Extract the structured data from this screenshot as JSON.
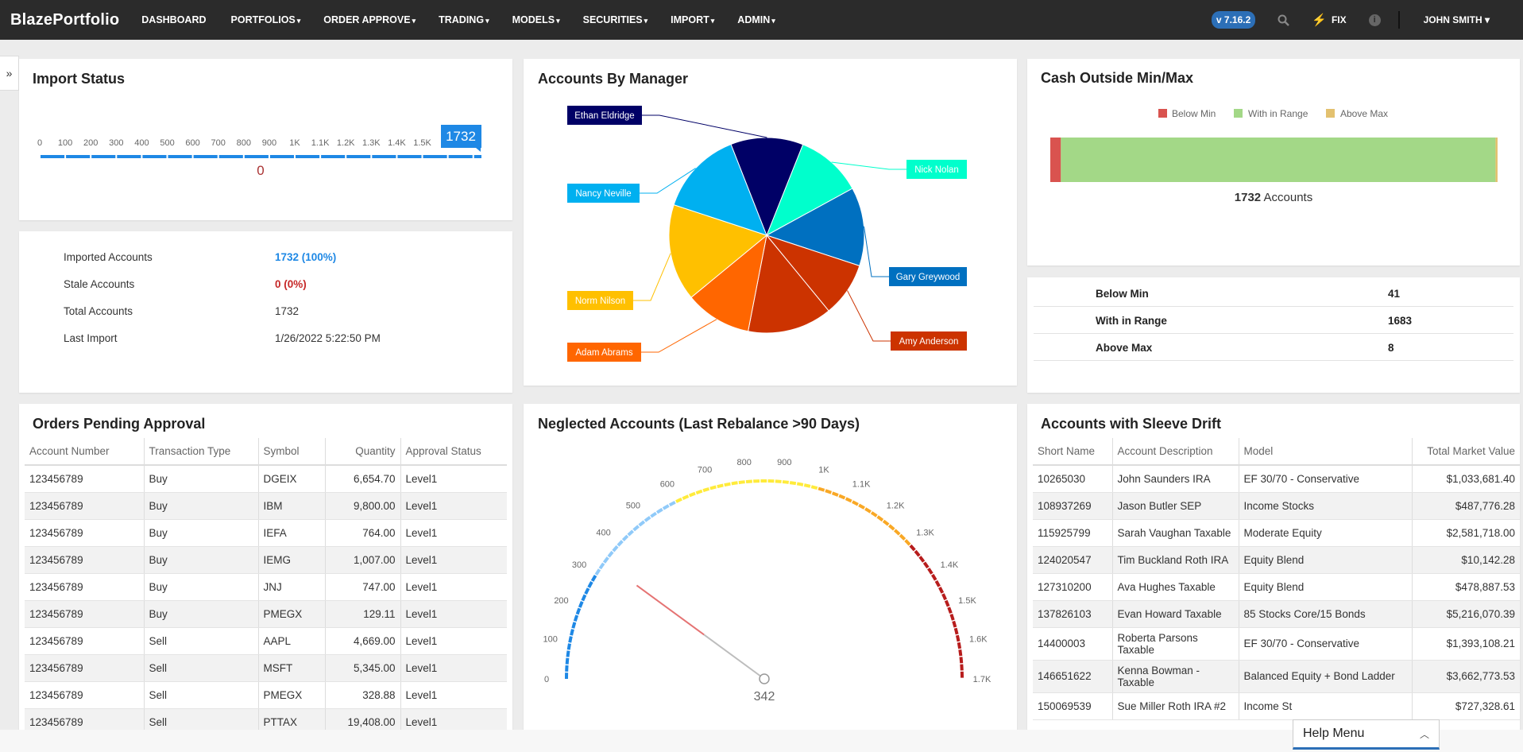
{
  "nav": {
    "logo": "BlazePortfolio",
    "items": [
      {
        "label": "DASHBOARD",
        "caret": ""
      },
      {
        "label": "PORTFOLIOS",
        "caret": "▾"
      },
      {
        "label": "ORDER APPROVE",
        "caret": "▾"
      },
      {
        "label": "TRADING",
        "caret": "▾"
      },
      {
        "label": "MODELS",
        "caret": "▾"
      },
      {
        "label": "SECURITIES",
        "caret": "▾"
      },
      {
        "label": "IMPORT",
        "caret": "▾"
      },
      {
        "label": "ADMIN",
        "caret": "▾"
      }
    ],
    "version": "v 7.16.2",
    "fix_label": "FIX",
    "user": "JOHN SMITH ▾",
    "icons": [
      "search-icon",
      "bolt-icon",
      "info-icon"
    ]
  },
  "import_status": {
    "title": "Import Status",
    "scale_labels": [
      "0",
      "100",
      "200",
      "300",
      "400",
      "500",
      "600",
      "700",
      "800",
      "900",
      "1K",
      "1.1K",
      "1.2K",
      "1.3K",
      "1.4K",
      "1.5K"
    ],
    "scale_max": 1732,
    "current_value": "1732",
    "lower_value": "0"
  },
  "import_stats": {
    "rows": [
      {
        "label": "Imported Accounts",
        "value": "1732 (100%)",
        "color": "#1e88e5"
      },
      {
        "label": "Stale Accounts",
        "value": "0 (0%)",
        "color": "#c62828"
      },
      {
        "label": "Total Accounts",
        "value": "1732",
        "color": "#333333"
      },
      {
        "label": "Last Import",
        "value": "1/26/2022 5:22:50 PM",
        "color": "#333333"
      }
    ]
  },
  "accounts_by_manager": {
    "title": "Accounts By Manager"
  },
  "cash_minmax": {
    "title": "Cash Outside Min/Max",
    "legend": [
      {
        "label": "Below Min",
        "color": "#d9534f"
      },
      {
        "label": "With in Range",
        "color": "#a3d887"
      },
      {
        "label": "Above Max",
        "color": "#e3c16f"
      }
    ],
    "total_number": "1732",
    "total_suffix": "Accounts",
    "rows": [
      {
        "label": "Below Min",
        "value": "41"
      },
      {
        "label": "With in Range",
        "value": "1683"
      },
      {
        "label": "Above Max",
        "value": "8"
      }
    ]
  },
  "orders_pending": {
    "title": "Orders Pending Approval",
    "columns": [
      "Account Number",
      "Transaction Type",
      "Symbol",
      "Quantity",
      "Approval Status"
    ],
    "rows": [
      [
        "123456789",
        "Buy",
        "DGEIX",
        "6,654.70",
        "Level1"
      ],
      [
        "123456789",
        "Buy",
        "IBM",
        "9,800.00",
        "Level1"
      ],
      [
        "123456789",
        "Buy",
        "IEFA",
        "764.00",
        "Level1"
      ],
      [
        "123456789",
        "Buy",
        "IEMG",
        "1,007.00",
        "Level1"
      ],
      [
        "123456789",
        "Buy",
        "JNJ",
        "747.00",
        "Level1"
      ],
      [
        "123456789",
        "Buy",
        "PMEGX",
        "129.11",
        "Level1"
      ],
      [
        "123456789",
        "Sell",
        "AAPL",
        "4,669.00",
        "Level1"
      ],
      [
        "123456789",
        "Sell",
        "MSFT",
        "5,345.00",
        "Level1"
      ],
      [
        "123456789",
        "Sell",
        "PMEGX",
        "328.88",
        "Level1"
      ],
      [
        "123456789",
        "Sell",
        "PTTAX",
        "19,408.00",
        "Level1"
      ]
    ]
  },
  "neglected": {
    "title": "Neglected Accounts (Last Rebalance >90 Days)",
    "value_label": "342"
  },
  "sleeve_drift": {
    "title": "Accounts with Sleeve Drift",
    "columns": [
      "Short Name",
      "Account Description",
      "Model",
      "Total Market Value"
    ],
    "rows": [
      [
        "10265030",
        "John Saunders IRA",
        "",
        "EF 30/70 - Conservative",
        "$1,033,681.40"
      ],
      [
        "108937269",
        "Jason Butler SEP",
        "",
        "Income Stocks",
        "$487,776.28"
      ],
      [
        "115925799",
        "Sarah Vaughan Taxable",
        "",
        "Moderate Equity",
        "$2,581,718.00"
      ],
      [
        "124020547",
        "Tim Buckland Roth IRA",
        "",
        "Equity Blend",
        "$10,142.28"
      ],
      [
        "127310200",
        "Ava Hughes Taxable",
        "",
        "Equity Blend",
        "$478,887.53"
      ],
      [
        "137826103",
        "Evan Howard Taxable",
        "",
        "85 Stocks Core/15 Bonds",
        "$5,216,070.39"
      ],
      [
        "14400003",
        "Roberta Parsons",
        "Taxable",
        "EF 30/70 - Conservative",
        "$1,393,108.21"
      ],
      [
        "146651622",
        "Kenna Bowman -",
        "Taxable",
        "Balanced Equity + Bond Ladder",
        "$3,662,773.53"
      ],
      [
        "150069539",
        "Sue Miller Roth IRA #2",
        "",
        "Income St",
        "$727,328.61"
      ]
    ]
  },
  "chart_data": [
    {
      "type": "pie",
      "title": "Accounts By Manager",
      "series": [
        {
          "name": "",
          "values": [
            11,
            13,
            9,
            14,
            11,
            16,
            14,
            12
          ]
        }
      ],
      "categories": [
        "Nick Nolan",
        "Gary Greywood",
        "Amy Anderson",
        "",
        "Adam Abrams",
        "Norm Nilson",
        "Nancy Neville",
        "Ethan Eldridge"
      ],
      "colors": [
        "#00ffcc",
        "#0070c0",
        "#cc3300",
        "#cc3300",
        "#ff6600",
        "#ffc000",
        "#00b0f0",
        "#000066"
      ]
    },
    {
      "type": "bar",
      "title": "Cash Outside Min/Max",
      "categories": [
        "Below Min",
        "With in Range",
        "Above Max"
      ],
      "values": [
        41,
        1683,
        8
      ],
      "colors": [
        "#d9534f",
        "#a3d887",
        "#e3c16f"
      ]
    },
    {
      "type": "gauge",
      "title": "Neglected Accounts (Last Rebalance >90 Days)",
      "min": 0,
      "max": 1700,
      "value": 342,
      "tick_labels": [
        "0",
        "100",
        "200",
        "300",
        "400",
        "500",
        "600",
        "700",
        "800",
        "900",
        "1K",
        "1.1K",
        "1.2K",
        "1.3K",
        "1.4K",
        "1.5K",
        "1.6K",
        "1.7K"
      ]
    }
  ]
}
